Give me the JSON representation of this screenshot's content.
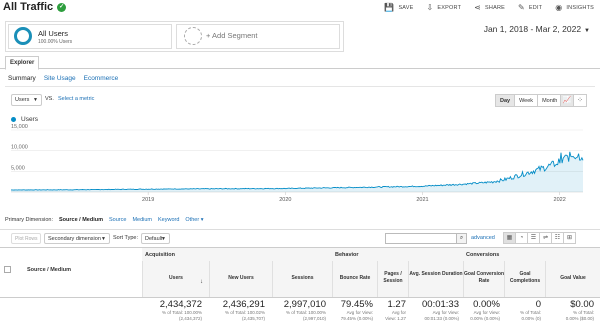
{
  "header": {
    "title": "All Traffic",
    "actions": [
      "SAVE",
      "EXPORT",
      "SHARE",
      "EDIT",
      "INSIGHTS"
    ]
  },
  "segments": {
    "active_name": "All Users",
    "active_sub": "100.00% Users",
    "add_label": "+ Add Segment"
  },
  "date_range": "Jan 1, 2018 - Mar 2, 2022",
  "tabs": {
    "explorer": "Explorer"
  },
  "subnav": [
    "Summary",
    "Site Usage",
    "Ecommerce"
  ],
  "chart_controls": {
    "metric": "Users",
    "vs": "VS.",
    "select_metric": "Select a metric",
    "granularity": [
      "Day",
      "Week",
      "Month"
    ]
  },
  "chart_data": {
    "type": "area",
    "series": [
      {
        "name": "Users",
        "color": "#058dc7"
      }
    ],
    "yticks": [
      "15,000",
      "10,000",
      "5,000"
    ],
    "ylim": [
      0,
      15000
    ],
    "xticks": [
      "2019",
      "2020",
      "2021",
      "2022"
    ],
    "x_start": "2018-01-01",
    "x_end": "2022-03-02",
    "y_profile": [
      [
        2018.0,
        500
      ],
      [
        2018.5,
        550
      ],
      [
        2019.0,
        700
      ],
      [
        2019.5,
        780
      ],
      [
        2020.0,
        850
      ],
      [
        2020.5,
        1100
      ],
      [
        2021.0,
        1400
      ],
      [
        2021.3,
        1900
      ],
      [
        2021.5,
        2400
      ],
      [
        2021.6,
        3000
      ],
      [
        2021.7,
        4000
      ],
      [
        2021.8,
        5000
      ],
      [
        2021.9,
        6000
      ],
      [
        2022.0,
        7300
      ],
      [
        2022.1,
        9000
      ],
      [
        2022.16,
        8700
      ]
    ]
  },
  "primary_dimension": {
    "label": "Primary Dimension:",
    "active": "Source / Medium",
    "options": [
      "Source",
      "Medium",
      "Keyword",
      "Other"
    ]
  },
  "table_controls": {
    "plot_rows": "Plot Rows",
    "secondary_dimension": "Secondary dimension",
    "sort_type_label": "Sort Type:",
    "sort_type": "Default",
    "advanced": "advanced"
  },
  "table": {
    "groups": [
      "Acquisition",
      "Behavior",
      "Conversions"
    ],
    "dimension_header": "Source / Medium",
    "columns": [
      "Users",
      "New Users",
      "Sessions",
      "Bounce Rate",
      "Pages / Session",
      "Avg. Session Duration",
      "Goal Conversion Rate",
      "Goal Completions",
      "Goal Value"
    ],
    "totals": [
      {
        "value": "2,434,372",
        "sub1": "% of Total: 100.00%",
        "sub2": "(2,434,372)"
      },
      {
        "value": "2,436,291",
        "sub1": "% of Total: 100.02%",
        "sub2": "(2,435,707)"
      },
      {
        "value": "2,997,010",
        "sub1": "% of Total: 100.00%",
        "sub2": "(2,997,010)"
      },
      {
        "value": "79.45%",
        "sub1": "Avg for View:",
        "sub2": "79.45% (0.00%)"
      },
      {
        "value": "1.27",
        "sub1": "Avg for",
        "sub2": "View: 1.27"
      },
      {
        "value": "00:01:33",
        "sub1": "Avg for View:",
        "sub2": "00:01:33 (0.00%)"
      },
      {
        "value": "0.00%",
        "sub1": "Avg for View:",
        "sub2": "0.00% (0.00%)"
      },
      {
        "value": "0",
        "sub1": "% of Total:",
        "sub2": "0.00% (0)"
      },
      {
        "value": "$0.00",
        "sub1": "% of Total:",
        "sub2": "0.00% ($0.00)"
      }
    ]
  }
}
